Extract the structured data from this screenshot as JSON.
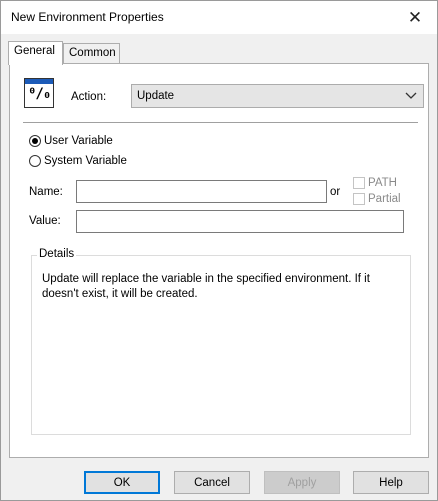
{
  "window": {
    "title": "New Environment Properties",
    "close_glyph": "✕"
  },
  "tabs": [
    {
      "label": "General"
    },
    {
      "label": "Common"
    }
  ],
  "action": {
    "icon_text": "%",
    "label": "Action:",
    "selected": "Update",
    "icon": "chevron-down-icon"
  },
  "variable_scope": {
    "user": {
      "label": "User Variable",
      "checked": true
    },
    "system": {
      "label": "System Variable",
      "checked": false
    }
  },
  "fields": {
    "name_label": "Name:",
    "name_value": "",
    "or_label": "or",
    "value_label": "Value:",
    "value_value": "",
    "path_label": "PATH",
    "partial_label": "Partial"
  },
  "details": {
    "title": "Details",
    "text": "Update will replace the variable in the specified environment. If it doesn't exist, it will be created."
  },
  "buttons": {
    "ok": "OK",
    "cancel": "Cancel",
    "apply": "Apply",
    "help": "Help"
  }
}
